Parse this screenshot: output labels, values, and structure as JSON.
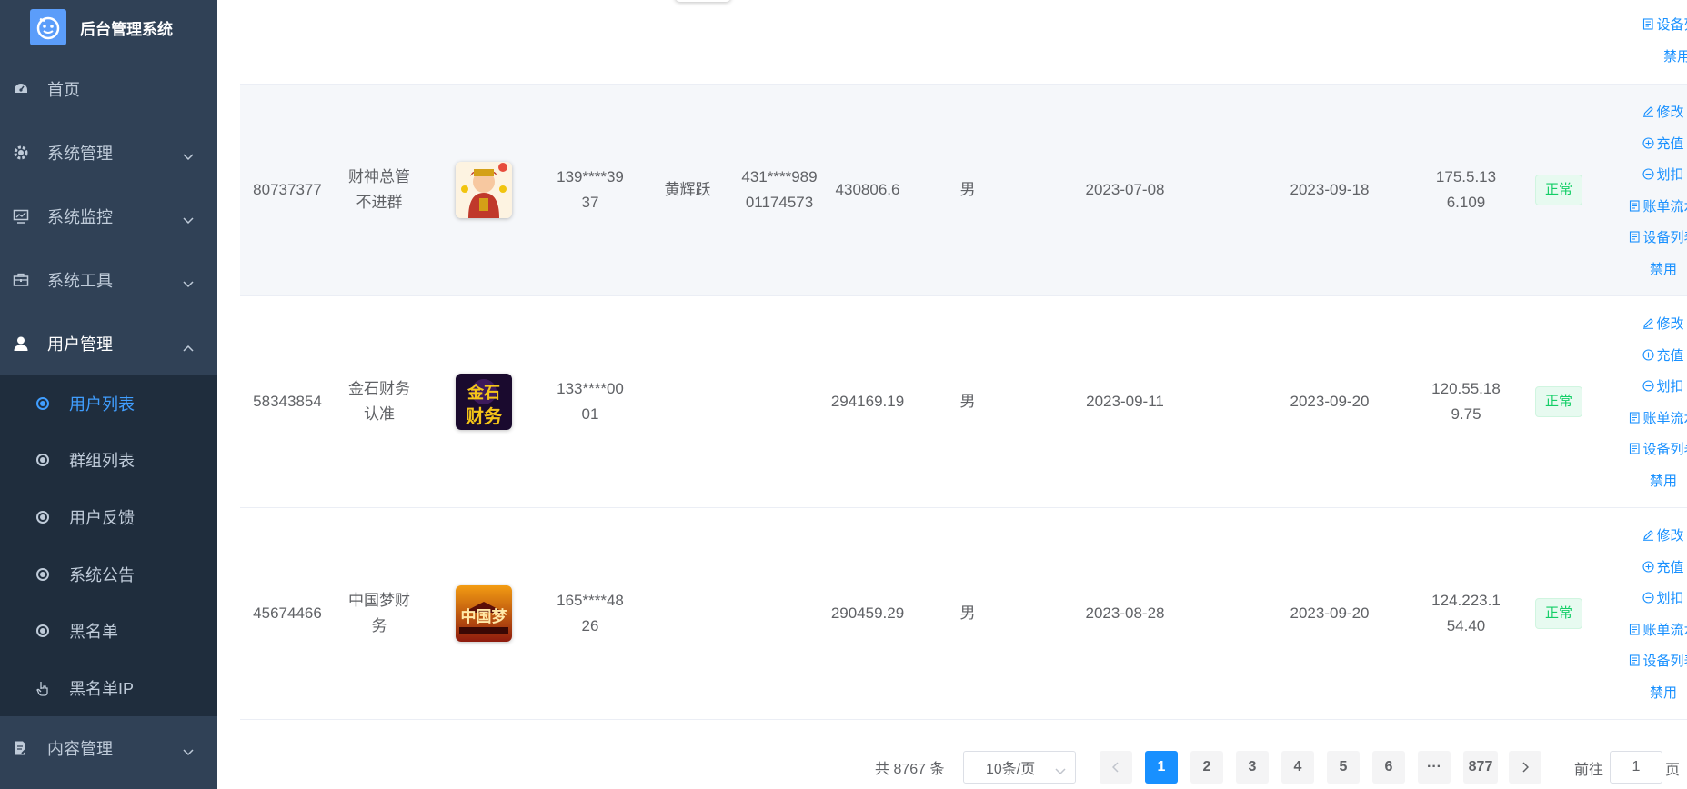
{
  "app": {
    "title": "后台管理系统"
  },
  "sidebar": {
    "menu": [
      {
        "label": "首页"
      },
      {
        "label": "系统管理"
      },
      {
        "label": "系统监控"
      },
      {
        "label": "系统工具"
      },
      {
        "label": "用户管理"
      },
      {
        "label": "内容管理"
      }
    ],
    "submenu": [
      {
        "label": "用户列表",
        "active": true
      },
      {
        "label": "群组列表"
      },
      {
        "label": "用户反馈"
      },
      {
        "label": "系统公告"
      },
      {
        "label": "黑名单"
      },
      {
        "label": "黑名单IP"
      }
    ]
  },
  "table": {
    "top_row_ops": [
      "设备列表",
      "禁用"
    ],
    "rows": [
      {
        "id": "80737377",
        "nickname": "财神总管不进群",
        "phone": "139****3937",
        "real_name": "黄辉跃",
        "id_card": "431****98901174573",
        "balance": "430806.6",
        "gender": "男",
        "reg_date": "2023-07-08",
        "last_date": "2023-09-18",
        "ip": "175.5.136.109",
        "status": "正常",
        "avatar_text": ""
      },
      {
        "id": "58343854",
        "nickname": "金石财务认准",
        "phone": "133****0001",
        "real_name": "",
        "id_card": "",
        "balance": "294169.19",
        "gender": "男",
        "reg_date": "2023-09-11",
        "last_date": "2023-09-20",
        "ip": "120.55.189.75",
        "status": "正常",
        "avatar_text": "财务"
      },
      {
        "id": "45674466",
        "nickname": "中国梦财务",
        "phone": "165****4826",
        "real_name": "",
        "id_card": "",
        "balance": "290459.29",
        "gender": "男",
        "reg_date": "2023-08-28",
        "last_date": "2023-09-20",
        "ip": "124.223.154.40",
        "status": "正常",
        "avatar_text": "中国梦"
      }
    ],
    "ops": [
      "修改",
      "充值",
      "划扣",
      "账单流水",
      "设备列表",
      "禁用"
    ]
  },
  "pagination": {
    "total": "共 8767 条",
    "page_size": "10条/页",
    "pages": [
      "1",
      "2",
      "3",
      "4",
      "5",
      "6",
      "···",
      "877"
    ],
    "current": "1",
    "goto_prefix": "前往",
    "goto_value": "1",
    "goto_suffix": "页"
  },
  "colors": {
    "sidebar_bg": "#304156",
    "submenu_bg": "#1f2d3d",
    "accent": "#1890ff",
    "success": "#13ce66"
  }
}
